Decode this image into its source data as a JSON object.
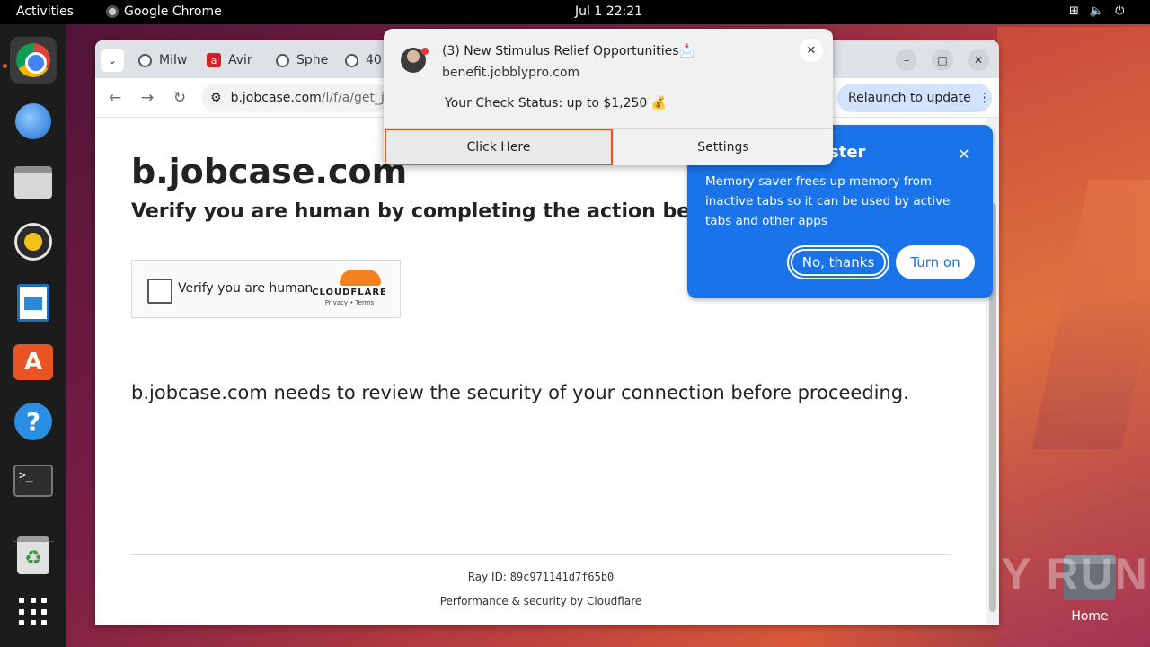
{
  "topbar": {
    "activities": "Activities",
    "app_name": "Google Chrome",
    "clock": "Jul 1  22:21",
    "tray_icons": [
      "network-icon",
      "volume-icon",
      "power-icon"
    ]
  },
  "dock": {
    "items": [
      "google-chrome",
      "thunderbird",
      "files",
      "rhythmbox",
      "libreoffice-writer",
      "app-center",
      "help",
      "terminal",
      "trash",
      "show-apps"
    ],
    "accent": "#e95420"
  },
  "desktop": {
    "home_label": "Home",
    "watermark": "ANY RUN"
  },
  "browser": {
    "tabs": [
      {
        "label": "Milw",
        "icon": "globe-icon"
      },
      {
        "label": "Avir",
        "icon": "avira-icon"
      },
      {
        "label": "Sphe",
        "icon": "globe-icon"
      },
      {
        "label": "40",
        "icon": "globe-icon"
      }
    ],
    "url_domain": "b.jobcase.com",
    "url_path": "/l/f/a/get_jo",
    "relaunch_label": "Relaunch to update"
  },
  "page": {
    "site_title": "b.jobcase.com",
    "subtitle": "Verify you are human by completing the action below.",
    "checkbox_label": "Verify you are human",
    "cloudflare_word": "CLOUDFLARE",
    "privacy": "Privacy",
    "terms": "Terms",
    "review_text": "b.jobcase.com needs to review the security of your connection before proceeding.",
    "ray_label": "Ray ID: ",
    "ray_id": "89c971141d7f65b0",
    "performance": "Performance & security by Cloudflare"
  },
  "memory_saver": {
    "title": "ster",
    "body": "Memory saver frees up memory from inactive tabs so it can be used by active tabs and other apps",
    "no_thanks": "No, thanks",
    "turn_on": "Turn on",
    "color": "#1a73e8"
  },
  "notification": {
    "title": "(3) New Stimulus Relief Opportunities📩",
    "source": "benefit.jobblypro.com",
    "body": "Your Check Status: up to $1,250 💰",
    "click_here": "Click Here",
    "settings": "Settings"
  }
}
